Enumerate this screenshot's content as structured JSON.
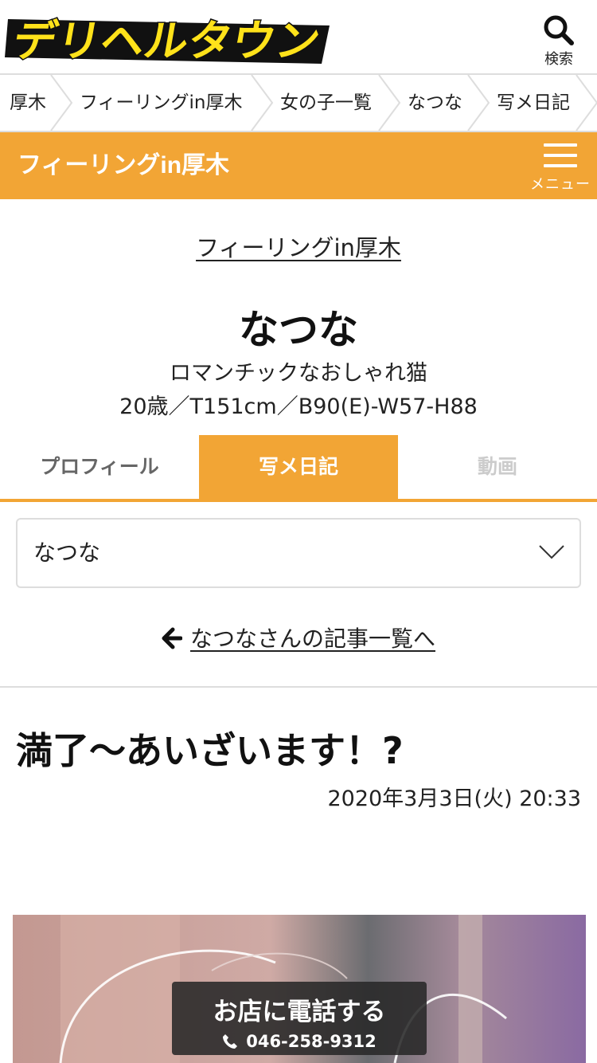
{
  "header": {
    "logo_text": "デリヘルタウン",
    "search_label": "検索"
  },
  "breadcrumb": [
    {
      "label": "厚木"
    },
    {
      "label": "フィーリングin厚木"
    },
    {
      "label": "女の子一覧"
    },
    {
      "label": "なつな"
    },
    {
      "label": "写メ日記"
    }
  ],
  "shopbar": {
    "title": "フィーリングin厚木",
    "menu_label": "メニュー"
  },
  "profile": {
    "shop_link": "フィーリングin厚木",
    "name": "なつな",
    "catchphrase": "ロマンチックなおしゃれ猫",
    "spec": "20歳／T151cm／B90(E)-W57-H88"
  },
  "tabs": [
    {
      "label": "プロフィール",
      "active": false
    },
    {
      "label": "写メ日記",
      "active": true
    },
    {
      "label": "動画",
      "active": false
    }
  ],
  "select": {
    "value": "なつな"
  },
  "back_link": "なつなさんの記事一覧へ",
  "article": {
    "title": "満了〜あいざいます！?",
    "date": "2020年3月3日(火) 20:33"
  },
  "call": {
    "title": "お店に電話する",
    "number": "046-258-9312"
  },
  "colors": {
    "accent": "#f2a535",
    "logo_yellow": "#ffe21a",
    "text": "#222222",
    "border": "#dddddd"
  },
  "icons": [
    "search-icon",
    "chevron-right-icon",
    "hamburger-icon",
    "chevron-down-icon",
    "arrow-left-icon",
    "phone-icon"
  ]
}
